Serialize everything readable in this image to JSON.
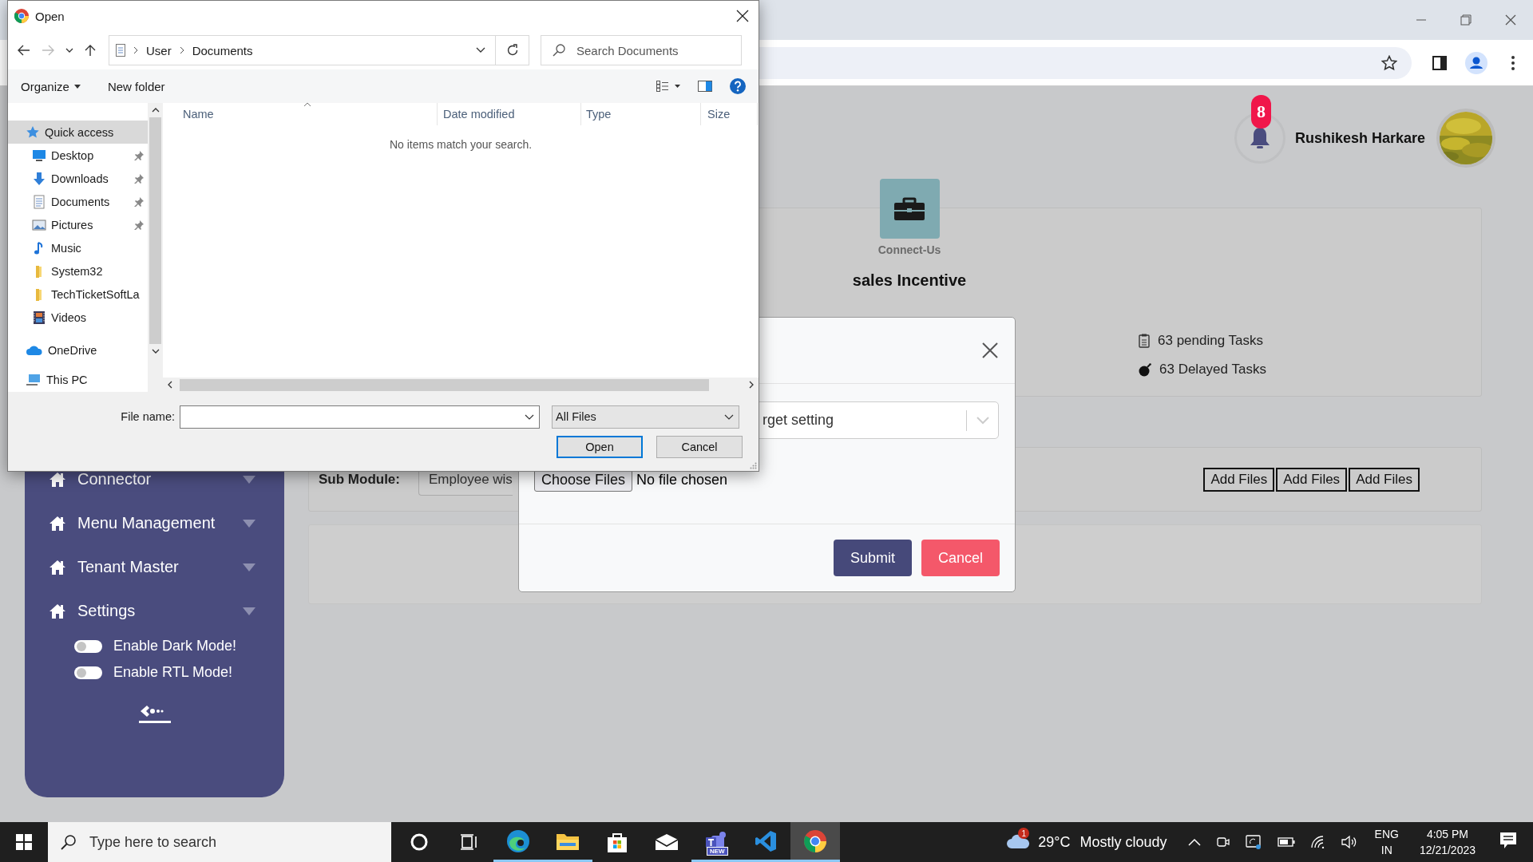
{
  "dialog": {
    "title": "Open",
    "breadcrumb": [
      "User",
      "Documents"
    ],
    "search": {
      "placeholder": "Search Documents"
    },
    "toolbar": [
      {
        "label": "Organize",
        "kind": "menu"
      },
      {
        "label": "New folder",
        "kind": "button"
      }
    ],
    "nav": [
      {
        "label": "Quick access",
        "kind": "star",
        "selected": true,
        "children": [
          {
            "label": "Desktop",
            "kind": "desktop",
            "pinned": true,
            "selected": false
          },
          {
            "label": "Downloads",
            "kind": "download",
            "pinned": true,
            "selected": false
          },
          {
            "label": "Documents",
            "kind": "document",
            "pinned": true,
            "selected": false
          },
          {
            "label": "Pictures",
            "kind": "picture",
            "pinned": true,
            "selected": false
          },
          {
            "label": "Music",
            "kind": "music",
            "pinned": false,
            "selected": false
          },
          {
            "label": "System32",
            "kind": "folder",
            "pinned": false,
            "selected": false
          },
          {
            "label": "TechTicketSoftLa",
            "kind": "folder",
            "pinned": false,
            "selected": false
          },
          {
            "label": "Videos",
            "kind": "video",
            "pinned": false,
            "selected": false
          }
        ]
      },
      {
        "label": "OneDrive",
        "kind": "cloud",
        "selected": false
      },
      {
        "label": "This PC",
        "kind": "pc",
        "selected": false
      }
    ],
    "columns": [
      {
        "label": "Name",
        "sorted": true
      },
      {
        "label": "Date modified",
        "sorted": false
      },
      {
        "label": "Type",
        "sorted": false
      },
      {
        "label": "Size",
        "sorted": false
      }
    ],
    "empty_message": "No items match your search.",
    "file_name": {
      "label": "File name:"
    },
    "file_type": "All Files",
    "buttons": [
      {
        "label": "Open",
        "default": true
      },
      {
        "label": "Cancel",
        "default": false
      }
    ]
  },
  "sidebar": {
    "items": [
      {
        "label": "Connector"
      },
      {
        "label": "Menu Management"
      },
      {
        "label": "Tenant Master"
      },
      {
        "label": "Settings"
      }
    ],
    "toggles": [
      {
        "label": "Enable Dark Mode!",
        "on": false
      },
      {
        "label": "Enable RTL Mode!",
        "on": false
      }
    ]
  },
  "header": {
    "notifications": "8",
    "user_name": "Rushikesh Harkare"
  },
  "summary": {
    "tile_label": "Connect-Us",
    "title": "sales Incentive",
    "tasks": [
      {
        "kind": "pending",
        "text": "63 pending Tasks"
      },
      {
        "kind": "delayed",
        "text": "63 Delayed Tasks"
      }
    ]
  },
  "sub_module": {
    "label": "Sub Module:",
    "value": "Employee wis",
    "buttons": [
      "Add Files",
      "Add Files",
      "Add Files"
    ]
  },
  "modal": {
    "select_value": "rget setting",
    "file_input": {
      "button": "Choose Files",
      "status": "No file chosen"
    },
    "buttons": [
      {
        "label": "Submit",
        "kind": "primary"
      },
      {
        "label": "Cancel",
        "kind": "danger"
      }
    ]
  },
  "taskbar": {
    "search": {
      "placeholder": "Type here to search"
    },
    "apps": [
      {
        "kind": "cortana",
        "running": false,
        "selected": false
      },
      {
        "kind": "task-view",
        "running": false,
        "selected": false
      },
      {
        "kind": "edge",
        "running": true,
        "selected": false
      },
      {
        "kind": "explorer",
        "running": true,
        "selected": false
      },
      {
        "kind": "store",
        "running": false,
        "selected": false
      },
      {
        "kind": "mail",
        "running": false,
        "selected": false
      },
      {
        "kind": "teams",
        "running": true,
        "selected": false,
        "badge": "NEW"
      },
      {
        "kind": "vscode",
        "running": true,
        "selected": false
      },
      {
        "kind": "chrome",
        "running": true,
        "selected": true
      }
    ],
    "weather": {
      "badge": "1",
      "temperature": "29°C",
      "condition": "Mostly cloudy"
    },
    "language": {
      "code": "ENG",
      "region": "IN"
    },
    "time": "4:05 PM",
    "date": "12/21/2023"
  }
}
